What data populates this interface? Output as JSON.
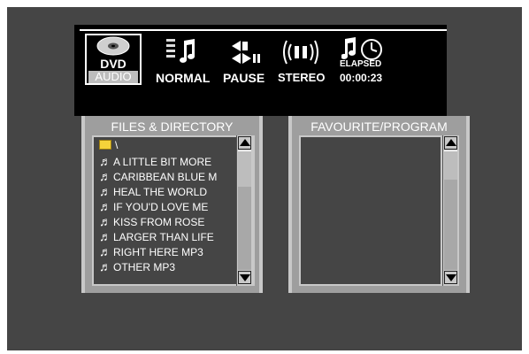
{
  "toolbar": {
    "disc_type": "DVD",
    "media_type": "AUDIO",
    "play_mode": "NORMAL",
    "playback_state": "PAUSE",
    "audio_channel": "STEREO",
    "time_mode": "ELAPSED",
    "time_value": "00:00:23"
  },
  "files_panel": {
    "title": "FILES & DIRECTORY",
    "folder": "\\",
    "items": [
      "A LITTLE BIT MORE",
      "CARIBBEAN BLUE M",
      "HEAL THE WORLD",
      "IF YOU'D LOVE ME",
      "KISS FROM ROSE",
      "LARGER THAN LIFE",
      "RIGHT HERE MP3",
      "OTHER MP3"
    ]
  },
  "favourite_panel": {
    "title": "FAVOURITE/PROGRAM",
    "items": []
  },
  "icons": {
    "disc": "disc-icon",
    "play_mode": "music-list-icon",
    "playback": "pause-icon",
    "audio": "stereo-icon",
    "time": "clock-icon",
    "track": "music-note-icon",
    "folder": "folder-icon"
  },
  "colors": {
    "background": "#454545",
    "toolbar": "#000000",
    "panel_border": "#c8c8c8",
    "folder": "#f5d33a"
  }
}
